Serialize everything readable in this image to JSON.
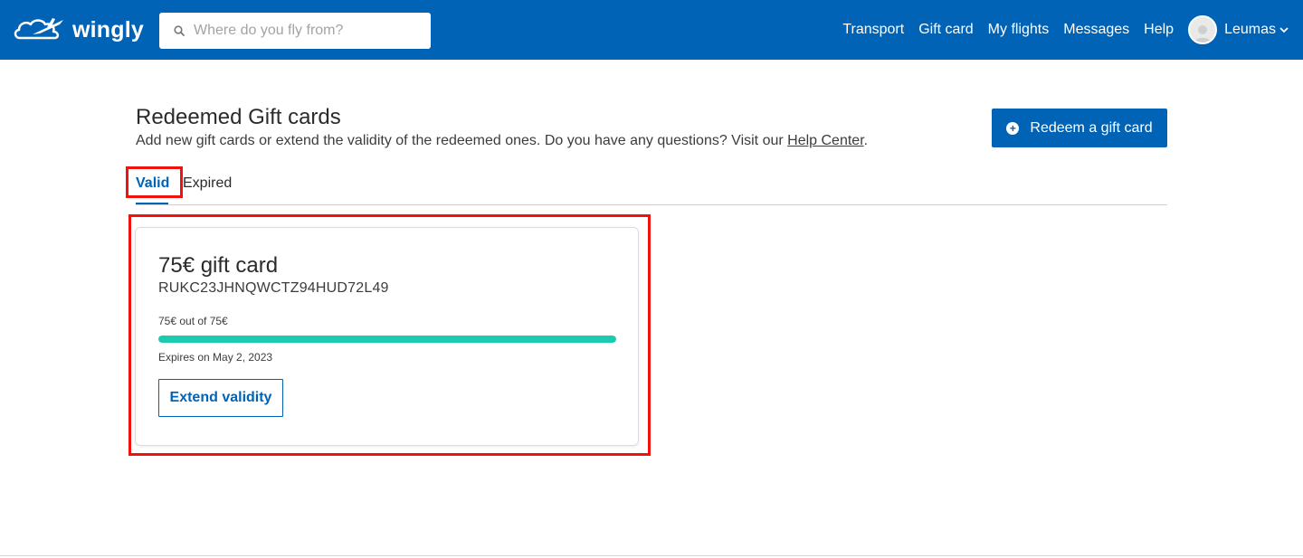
{
  "brand": {
    "name": "wingly",
    "color": "#0063b5"
  },
  "search": {
    "placeholder": "Where do you fly from?",
    "icon": "search-icon"
  },
  "nav": {
    "items": [
      "Transport",
      "Gift card",
      "My flights",
      "Messages",
      "Help"
    ],
    "user_name": "Leumas"
  },
  "page": {
    "title": "Redeemed Gift cards",
    "subtitle_text": "Add new gift cards or extend the validity of the redeemed ones. Do you have any questions? Visit our ",
    "help_link": "Help Center",
    "subtitle_end": ".",
    "redeem_button": "Redeem a gift card"
  },
  "tabs": [
    {
      "label": "Valid",
      "active": true
    },
    {
      "label": "Expired",
      "active": false
    }
  ],
  "gift_card": {
    "title": "75€ gift card",
    "code": "RUKC23JHNQWCTZ94HUD72L49",
    "amount_text": "75€ out of 75€",
    "remaining_fraction": 1.0,
    "progress_color": "#1bcbae",
    "expires": "Expires on May 2, 2023",
    "extend_button": "Extend validity"
  },
  "highlight_color": "#f2120b"
}
